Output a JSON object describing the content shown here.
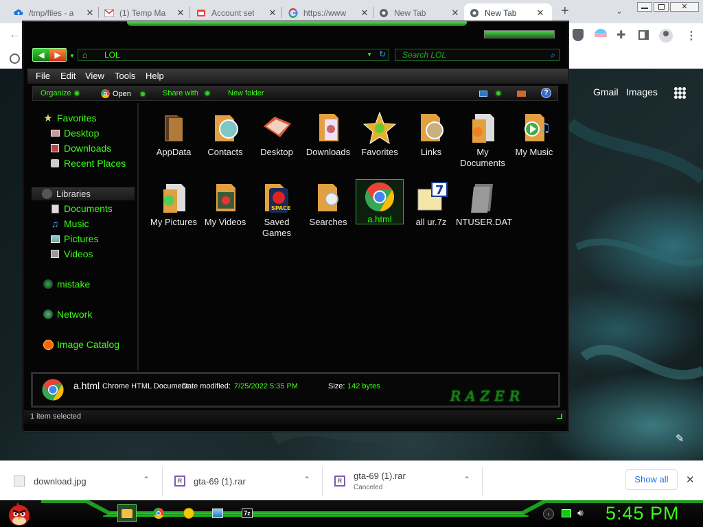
{
  "browser": {
    "tabs": [
      {
        "title": "/tmp/files - a"
      },
      {
        "title": "(1) Temp Ma"
      },
      {
        "title": "Account sett"
      },
      {
        "title": "https://www."
      },
      {
        "title": "New Tab"
      },
      {
        "title": "New Tab"
      }
    ],
    "new_tab_label": "+",
    "google_links": [
      "Gmail",
      "Images"
    ]
  },
  "explorer": {
    "address": "LOL",
    "search_placeholder": "Search LOL",
    "menu": [
      "File",
      "Edit",
      "View",
      "Tools",
      "Help"
    ],
    "commands": [
      "Organize",
      "Open",
      "Share with",
      "New folder"
    ],
    "nav": {
      "favorites_label": "Favorites",
      "favorites": [
        "Desktop",
        "Downloads",
        "Recent Places"
      ],
      "libraries_label": "Libraries",
      "libraries": [
        "Documents",
        "Music",
        "Pictures",
        "Videos"
      ],
      "other": [
        "mistake",
        "Network",
        "Image Catalog"
      ]
    },
    "files": [
      {
        "name": "AppData"
      },
      {
        "name": "Contacts"
      },
      {
        "name": "Desktop"
      },
      {
        "name": "Downloads"
      },
      {
        "name": "Favorites"
      },
      {
        "name": "Links"
      },
      {
        "name": "My Documents"
      },
      {
        "name": "My Music"
      },
      {
        "name": "My Pictures"
      },
      {
        "name": "My Videos"
      },
      {
        "name": "Saved Games"
      },
      {
        "name": "Searches"
      },
      {
        "name": "a.html"
      },
      {
        "name": "all ur.7z"
      },
      {
        "name": "NTUSER.DAT"
      }
    ],
    "selected_file": "a.html",
    "details": {
      "name": "a.html",
      "type": "Chrome HTML Document",
      "date_label": "Date modified:",
      "date": "7/25/2022 5:35 PM",
      "size_label": "Size:",
      "size": "142 bytes",
      "brand": "RAZER"
    },
    "status": "1 item selected"
  },
  "downloads": {
    "items": [
      {
        "name": "download.jpg",
        "status": ""
      },
      {
        "name": "gta-69 (1).rar",
        "status": ""
      },
      {
        "name": "gta-69 (1).rar",
        "status": "Canceled"
      }
    ],
    "show_all": "Show all"
  },
  "taskbar": {
    "clock": "5:45 PM"
  },
  "colors": {
    "accent_green": "#39ff14",
    "chrome_tab_bar": "#dee1e6",
    "explorer_bg": "#050505"
  }
}
